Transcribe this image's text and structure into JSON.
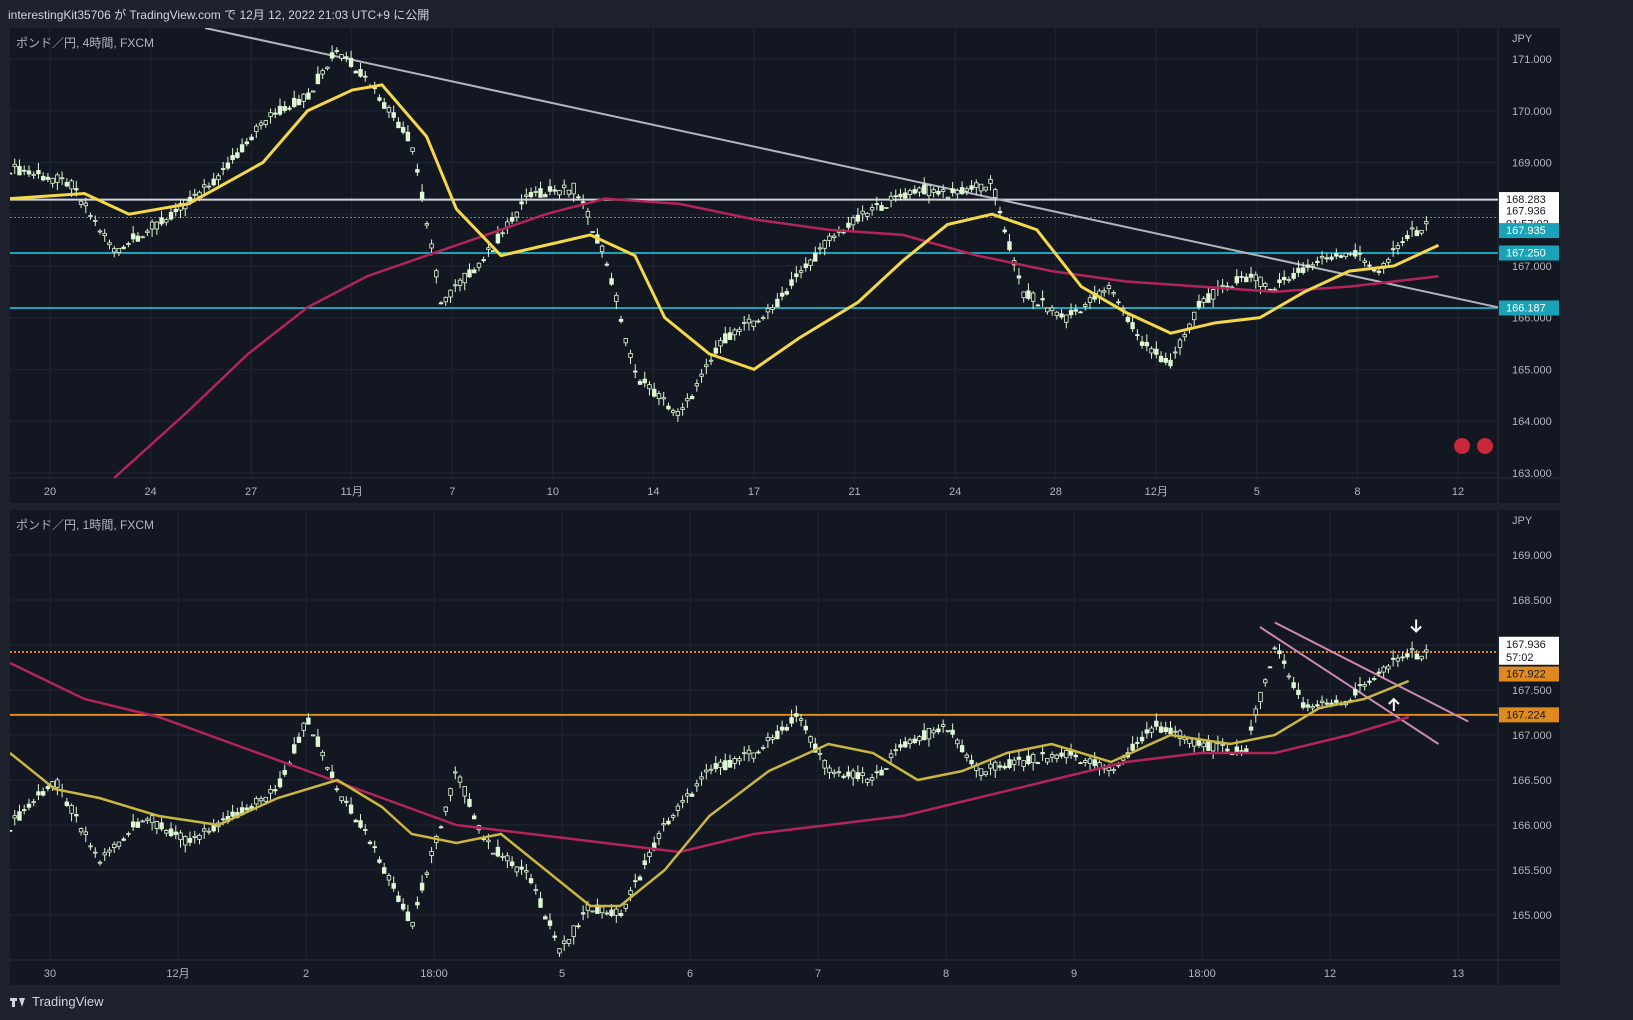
{
  "header": {
    "publisher": "interestingKit35706 が TradingView.com で 12月 12, 2022 21:03 UTC+9 に公開"
  },
  "footer": {
    "brand": "TradingView",
    "logo_icon": "tradingview-logo-icon"
  },
  "colors": {
    "bg": "#131722",
    "up": "#dff7d5",
    "down": "#131722",
    "ma_short": "#f5d847",
    "ma_long": "#b3245a",
    "trend": "#b2b5be",
    "hline_white": "#d1d4dc",
    "cyan": "#1aa3b8",
    "orange": "#e08a1e"
  },
  "chart_data": [
    {
      "type": "candlestick",
      "pane_label": "ポンド／円, 4時間, FXCM",
      "currency": "JPY",
      "ylim": [
        162.9,
        171.6
      ],
      "y_ticks": [
        "171.000",
        "170.000",
        "169.000",
        "168.000",
        "167.000",
        "166.000",
        "165.000",
        "164.000",
        "163.000"
      ],
      "x_ticks": [
        "20",
        "24",
        "27",
        "11月",
        "7",
        "10",
        "14",
        "17",
        "21",
        "24",
        "28",
        "12月",
        "5",
        "8",
        "12"
      ],
      "price_labels": [
        {
          "text": "168.283",
          "kind": "white"
        },
        {
          "text": "167.936",
          "sub": "01:57:02",
          "kind": "current"
        },
        {
          "text": "167.935",
          "kind": "cyan"
        },
        {
          "text": "167.250",
          "kind": "cyan"
        },
        {
          "text": "166.187",
          "kind": "cyan"
        }
      ],
      "hlines": [
        168.283,
        167.936,
        167.25,
        166.187
      ],
      "trendline": [
        [
          0.0,
          171.6
        ],
        [
          1.0,
          166.2
        ]
      ],
      "path": [
        [
          0,
          168.9
        ],
        [
          0.04,
          168.6
        ],
        [
          0.07,
          167.3
        ],
        [
          0.11,
          168.0
        ],
        [
          0.14,
          168.7
        ],
        [
          0.17,
          169.8
        ],
        [
          0.2,
          170.3
        ],
        [
          0.22,
          171.2
        ],
        [
          0.24,
          170.6
        ],
        [
          0.27,
          169.4
        ],
        [
          0.29,
          166.3
        ],
        [
          0.32,
          167.2
        ],
        [
          0.35,
          168.4
        ],
        [
          0.38,
          168.5
        ],
        [
          0.4,
          167.2
        ],
        [
          0.42,
          164.9
        ],
        [
          0.45,
          164.1
        ],
        [
          0.48,
          165.6
        ],
        [
          0.51,
          166.1
        ],
        [
          0.55,
          167.5
        ],
        [
          0.58,
          168.1
        ],
        [
          0.61,
          168.5
        ],
        [
          0.63,
          168.4
        ],
        [
          0.66,
          168.6
        ],
        [
          0.68,
          166.5
        ],
        [
          0.71,
          166.0
        ],
        [
          0.74,
          166.6
        ],
        [
          0.76,
          165.5
        ],
        [
          0.78,
          165.1
        ],
        [
          0.8,
          166.3
        ],
        [
          0.83,
          166.8
        ],
        [
          0.85,
          166.6
        ],
        [
          0.88,
          167.1
        ],
        [
          0.9,
          167.3
        ],
        [
          0.92,
          166.9
        ],
        [
          0.94,
          167.6
        ],
        [
          0.96,
          167.9
        ]
      ],
      "ma_short": [
        [
          0,
          168.3
        ],
        [
          0.05,
          168.4
        ],
        [
          0.08,
          168.0
        ],
        [
          0.12,
          168.2
        ],
        [
          0.17,
          169.0
        ],
        [
          0.2,
          170.0
        ],
        [
          0.23,
          170.4
        ],
        [
          0.25,
          170.5
        ],
        [
          0.28,
          169.5
        ],
        [
          0.3,
          168.1
        ],
        [
          0.33,
          167.2
        ],
        [
          0.36,
          167.4
        ],
        [
          0.39,
          167.6
        ],
        [
          0.42,
          167.2
        ],
        [
          0.44,
          166.0
        ],
        [
          0.47,
          165.3
        ],
        [
          0.5,
          165.0
        ],
        [
          0.53,
          165.6
        ],
        [
          0.57,
          166.3
        ],
        [
          0.6,
          167.1
        ],
        [
          0.63,
          167.8
        ],
        [
          0.66,
          168.0
        ],
        [
          0.69,
          167.7
        ],
        [
          0.72,
          166.6
        ],
        [
          0.75,
          166.1
        ],
        [
          0.78,
          165.7
        ],
        [
          0.81,
          165.9
        ],
        [
          0.84,
          166.0
        ],
        [
          0.87,
          166.5
        ],
        [
          0.9,
          166.9
        ],
        [
          0.93,
          167.0
        ],
        [
          0.96,
          167.4
        ]
      ],
      "ma_long": [
        [
          0.07,
          162.9
        ],
        [
          0.12,
          164.2
        ],
        [
          0.16,
          165.3
        ],
        [
          0.2,
          166.2
        ],
        [
          0.24,
          166.8
        ],
        [
          0.28,
          167.2
        ],
        [
          0.32,
          167.6
        ],
        [
          0.36,
          168.0
        ],
        [
          0.4,
          168.3
        ],
        [
          0.45,
          168.2
        ],
        [
          0.5,
          167.9
        ],
        [
          0.55,
          167.7
        ],
        [
          0.6,
          167.6
        ],
        [
          0.65,
          167.2
        ],
        [
          0.7,
          166.9
        ],
        [
          0.75,
          166.7
        ],
        [
          0.8,
          166.6
        ],
        [
          0.85,
          166.5
        ],
        [
          0.9,
          166.6
        ],
        [
          0.96,
          166.8
        ]
      ]
    },
    {
      "type": "candlestick",
      "pane_label": "ポンド／円, 1時間, FXCM",
      "currency": "JPY",
      "ylim": [
        164.5,
        169.5
      ],
      "y_ticks": [
        "169.000",
        "168.500",
        "168.000",
        "167.500",
        "167.000",
        "166.500",
        "166.000",
        "165.500",
        "165.000"
      ],
      "x_ticks": [
        "30",
        "12月",
        "2",
        "18:00",
        "5",
        "6",
        "7",
        "8",
        "9",
        "18:00",
        "12",
        "13"
      ],
      "price_labels": [
        {
          "text": "167.936",
          "sub": "57:02",
          "kind": "current"
        },
        {
          "text": "167.922",
          "kind": "orange"
        },
        {
          "text": "167.224",
          "kind": "orange"
        }
      ],
      "hlines": [
        167.922,
        167.224
      ],
      "trendlines": [
        [
          [
            0.85,
            168.25
          ],
          [
            0.98,
            167.15
          ]
        ],
        [
          [
            0.84,
            168.2
          ],
          [
            0.96,
            166.9
          ]
        ]
      ],
      "annotations": [
        "down-arrow-icon",
        "up-arrow-icon"
      ],
      "path": [
        [
          0,
          166.0
        ],
        [
          0.03,
          166.5
        ],
        [
          0.06,
          165.6
        ],
        [
          0.09,
          166.1
        ],
        [
          0.12,
          165.8
        ],
        [
          0.15,
          166.1
        ],
        [
          0.18,
          166.4
        ],
        [
          0.2,
          167.2
        ],
        [
          0.22,
          166.4
        ],
        [
          0.24,
          165.9
        ],
        [
          0.27,
          164.9
        ],
        [
          0.3,
          166.6
        ],
        [
          0.32,
          165.8
        ],
        [
          0.35,
          165.4
        ],
        [
          0.37,
          164.6
        ],
        [
          0.39,
          165.1
        ],
        [
          0.41,
          165.0
        ],
        [
          0.44,
          166.0
        ],
        [
          0.47,
          166.6
        ],
        [
          0.5,
          166.8
        ],
        [
          0.53,
          167.2
        ],
        [
          0.55,
          166.6
        ],
        [
          0.58,
          166.5
        ],
        [
          0.6,
          166.9
        ],
        [
          0.63,
          167.1
        ],
        [
          0.65,
          166.6
        ],
        [
          0.68,
          166.7
        ],
        [
          0.71,
          166.8
        ],
        [
          0.74,
          166.6
        ],
        [
          0.77,
          167.1
        ],
        [
          0.8,
          166.9
        ],
        [
          0.83,
          166.8
        ],
        [
          0.85,
          168.0
        ],
        [
          0.87,
          167.3
        ],
        [
          0.9,
          167.4
        ],
        [
          0.92,
          167.7
        ],
        [
          0.94,
          167.9
        ]
      ],
      "ma_short": [
        [
          0,
          166.8
        ],
        [
          0.03,
          166.4
        ],
        [
          0.06,
          166.3
        ],
        [
          0.1,
          166.1
        ],
        [
          0.14,
          166.0
        ],
        [
          0.18,
          166.3
        ],
        [
          0.22,
          166.5
        ],
        [
          0.25,
          166.2
        ],
        [
          0.27,
          165.9
        ],
        [
          0.3,
          165.8
        ],
        [
          0.33,
          165.9
        ],
        [
          0.36,
          165.5
        ],
        [
          0.39,
          165.1
        ],
        [
          0.41,
          165.1
        ],
        [
          0.44,
          165.5
        ],
        [
          0.47,
          166.1
        ],
        [
          0.51,
          166.6
        ],
        [
          0.55,
          166.9
        ],
        [
          0.58,
          166.8
        ],
        [
          0.61,
          166.5
        ],
        [
          0.64,
          166.6
        ],
        [
          0.67,
          166.8
        ],
        [
          0.7,
          166.9
        ],
        [
          0.74,
          166.7
        ],
        [
          0.78,
          167.0
        ],
        [
          0.82,
          166.9
        ],
        [
          0.85,
          167.0
        ],
        [
          0.88,
          167.3
        ],
        [
          0.91,
          167.4
        ],
        [
          0.94,
          167.6
        ]
      ],
      "ma_long": [
        [
          0,
          167.8
        ],
        [
          0.05,
          167.4
        ],
        [
          0.1,
          167.2
        ],
        [
          0.15,
          166.9
        ],
        [
          0.2,
          166.6
        ],
        [
          0.25,
          166.3
        ],
        [
          0.3,
          166.0
        ],
        [
          0.35,
          165.9
        ],
        [
          0.4,
          165.8
        ],
        [
          0.45,
          165.7
        ],
        [
          0.5,
          165.9
        ],
        [
          0.55,
          166.0
        ],
        [
          0.6,
          166.1
        ],
        [
          0.65,
          166.3
        ],
        [
          0.7,
          166.5
        ],
        [
          0.75,
          166.7
        ],
        [
          0.8,
          166.8
        ],
        [
          0.85,
          166.8
        ],
        [
          0.9,
          167.0
        ],
        [
          0.94,
          167.2
        ]
      ]
    }
  ]
}
